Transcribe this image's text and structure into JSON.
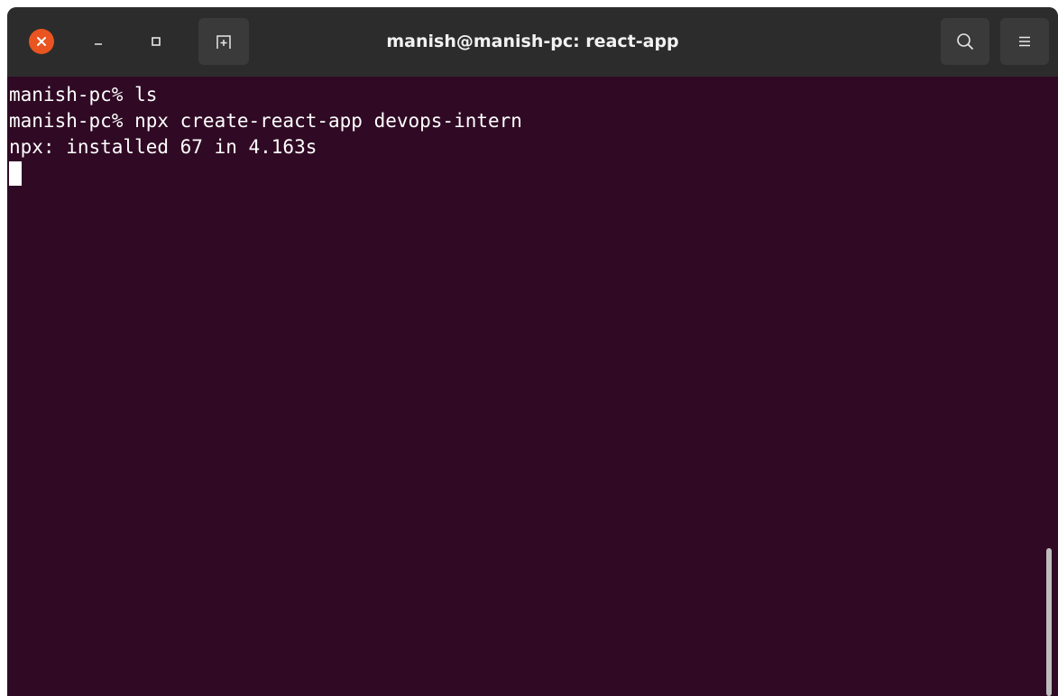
{
  "window": {
    "title": "manish@manish-pc: react-app"
  },
  "titlebar": {
    "icons": {
      "close": "close-icon",
      "minimize": "minimize-icon",
      "maximize": "maximize-icon",
      "new_tab": "new-tab-icon",
      "search": "search-icon",
      "menu": "hamburger-menu-icon"
    },
    "colors": {
      "titlebar_bg": "#2c2c2c",
      "close_button": "#e95420",
      "button_bg": "#3a3a3a"
    }
  },
  "terminal": {
    "background": "#300a24",
    "lines": [
      "manish-pc% ls",
      "manish-pc% npx create-react-app devops-intern",
      "npx: installed 67 in 4.163s"
    ]
  }
}
